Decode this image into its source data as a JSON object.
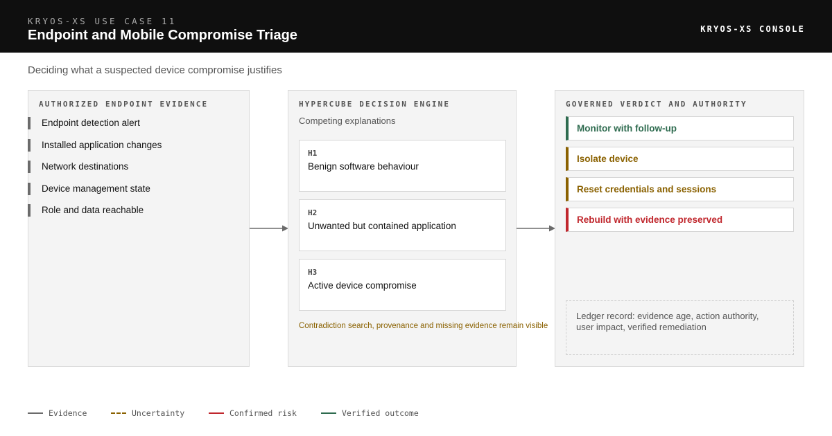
{
  "header": {
    "eyebrow": "KRYOS-XS USE CASE 11",
    "title": "Endpoint and Mobile Compromise Triage",
    "console_label": "KRYOS-XS CONSOLE"
  },
  "subtitle": "Deciding what a suspected device compromise justifies",
  "evidence_panel": {
    "title": "AUTHORIZED ENDPOINT EVIDENCE",
    "items": [
      "Endpoint detection alert",
      "Installed application changes",
      "Network destinations",
      "Device management state",
      "Role and data reachable"
    ]
  },
  "engine_panel": {
    "title": "HYPERCUBE DECISION ENGINE",
    "subtitle": "Competing explanations",
    "hypotheses": [
      {
        "id": "H1",
        "label": "Benign software behaviour"
      },
      {
        "id": "H2",
        "label": "Unwanted but contained application"
      },
      {
        "id": "H3",
        "label": "Active device compromise"
      }
    ],
    "note": "Contradiction search, provenance and missing evidence remain visible"
  },
  "verdict_panel": {
    "title": "GOVERNED VERDICT AND AUTHORITY",
    "verdicts": [
      {
        "label": "Monitor with follow-up",
        "color": "#2e6b4f"
      },
      {
        "label": "Isolate device",
        "color": "#8a6100"
      },
      {
        "label": "Reset credentials and sessions",
        "color": "#8a6100"
      },
      {
        "label": "Rebuild with evidence preserved",
        "color": "#c0272d"
      }
    ],
    "ledger_line1": "Ledger record: evidence age, action authority,",
    "ledger_line2": "user impact, verified remediation"
  },
  "legend": [
    {
      "label": "Evidence",
      "color": "#6b6b6b",
      "style": "solid"
    },
    {
      "label": "Uncertainty",
      "color": "#8a6100",
      "style": "dashed"
    },
    {
      "label": "Confirmed risk",
      "color": "#c0272d",
      "style": "solid"
    },
    {
      "label": "Verified outcome",
      "color": "#2e6b4f",
      "style": "solid"
    }
  ]
}
